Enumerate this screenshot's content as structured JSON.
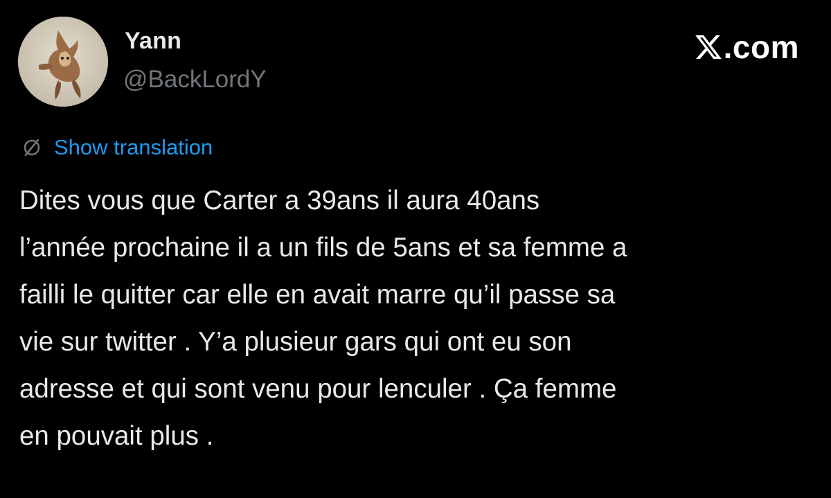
{
  "author": {
    "display_name": "Yann",
    "handle": "@BackLordY",
    "avatar": "avatar-photo-dog"
  },
  "brand": {
    "icon": "x-logo-icon",
    "text": ".com"
  },
  "translation": {
    "icon": "translate-icon",
    "label": "Show translation",
    "color": "#1d9bf0"
  },
  "tweet": {
    "text": "Dites vous que Carter a 39ans il aura 40ans\nl’année prochaine il a un fils de 5ans et sa femme a\nfailli le quitter car elle en avait marre qu’il passe sa\nvie sur twitter . Y’a plusieur gars qui ont eu son\nadresse et qui sont venu pour lenculer . Ça femme\nen pouvait plus ."
  },
  "colors": {
    "background": "#000000",
    "primary_text": "#e7e9ea",
    "secondary_text": "#71767b",
    "accent": "#1d9bf0"
  }
}
